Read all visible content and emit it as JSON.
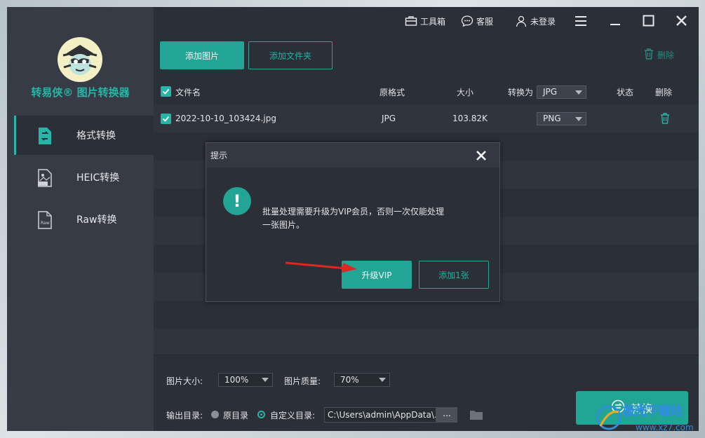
{
  "app": {
    "name": "转易侠® 图片转换器"
  },
  "sidebar": {
    "items": [
      {
        "label": "格式转换",
        "icon": "format-convert-icon",
        "active": true
      },
      {
        "label": "HEIC转换",
        "icon": "heic-file-icon",
        "active": false
      },
      {
        "label": "Raw转换",
        "icon": "raw-file-icon",
        "active": false
      }
    ]
  },
  "titlebar": {
    "toolbox": "工具箱",
    "service": "客服",
    "login": "未登录"
  },
  "toolbar": {
    "add_image": "添加图片",
    "add_folder": "添加文件夹",
    "delete": "删除"
  },
  "table": {
    "headers": {
      "filename": "文件名",
      "format": "原格式",
      "size": "大小",
      "convert_to": "转换为",
      "convert_to_value": "JPG",
      "status": "状态",
      "delete": "删除"
    },
    "rows": [
      {
        "filename": "2022-10-10_103424.jpg",
        "format": "JPG",
        "size": "103.82K",
        "target": "PNG",
        "checked": true
      }
    ]
  },
  "bottom": {
    "image_size_label": "图片大小:",
    "image_size_value": "100%",
    "image_quality_label": "图片质量:",
    "image_quality_value": "70%",
    "output_label": "输出目录:",
    "option_original": "原目录",
    "option_custom": "自定义目录:",
    "output_path": "C:\\Users\\admin\\AppData\\...",
    "browse": "...",
    "convert": "转换"
  },
  "dialog": {
    "title": "提示",
    "message": "批量处理需要升级为VIP会员，否则一次仅能处理一张图片。",
    "upgrade": "升级VIP",
    "add_one": "添加1张"
  },
  "colors": {
    "accent": "#23a596",
    "sidebar_bg": "#363b45",
    "main_bg": "#2b2f37"
  }
}
